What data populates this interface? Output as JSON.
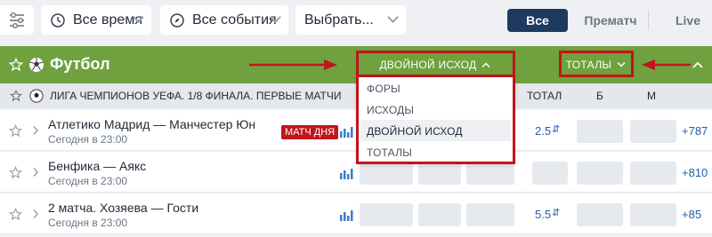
{
  "filters": {
    "time_label": "Все время",
    "events_label": "Все события",
    "select_label": "Выбрать..."
  },
  "toggles": {
    "all": "Все",
    "prematch": "Прематч",
    "live": "Live"
  },
  "sport": {
    "name": "Футбол",
    "double_chance": "ДВОЙНОЙ ИСХОД",
    "totals": "ТОТАЛЫ"
  },
  "dropdown": {
    "items": [
      "ФОРЫ",
      "ИСХОДЫ",
      "ДВОЙНОЙ ИСХОД",
      "ТОТАЛЫ"
    ]
  },
  "league": {
    "name": "ЛИГА ЧЕМПИОНОВ УЕФА. 1/8 ФИНАЛА. ПЕРВЫЕ МАТЧИ",
    "col_total": "ТОТАЛ",
    "col_b": "Б",
    "col_m": "М"
  },
  "matches": [
    {
      "title": "Атлетико Мадрид — Манчестер Юн",
      "time": "Сегодня в 23:00",
      "badge": "МАТЧ ДНЯ",
      "total": "2.5",
      "more": "+787"
    },
    {
      "title": "Бенфика — Аякс",
      "time": "Сегодня в 23:00",
      "badge": "",
      "total": "",
      "more": "+810"
    },
    {
      "title": "2 матча. Хозяева — Гости",
      "time": "Сегодня в 23:00",
      "badge": "",
      "total": "5.5",
      "more": "+85"
    }
  ],
  "colors": {
    "green": "#6fa13e",
    "dark_blue": "#1f3a5f",
    "red": "#c0151b",
    "link_blue": "#1f5fa8"
  },
  "icons": [
    "settings-sliders-icon",
    "clock-icon",
    "compass-icon",
    "chevron-down-icon",
    "star-icon",
    "soccer-ball-icon",
    "chevron-right-icon",
    "stats-icon",
    "arrow-right-icon",
    "arrow-left-icon",
    "chevron-up-icon"
  ]
}
